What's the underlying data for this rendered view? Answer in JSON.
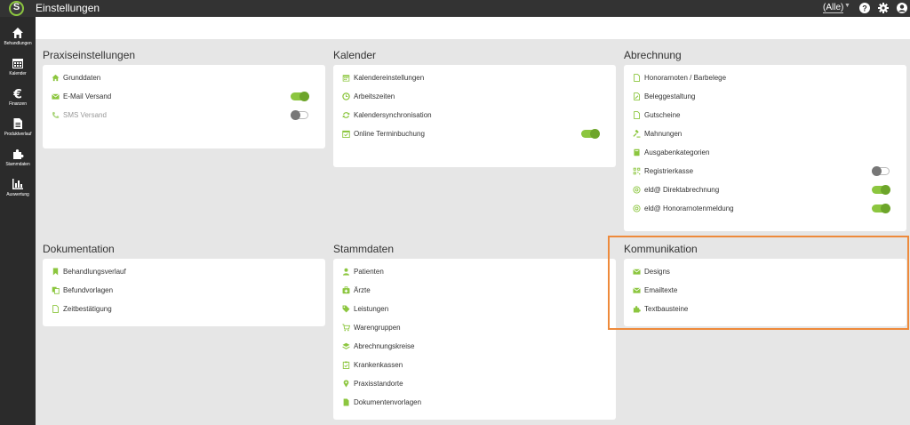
{
  "app": {
    "logo_letter": "S",
    "title": "Einstellungen",
    "filter_value": "(Alle)"
  },
  "colors": {
    "accent": "#8cc63f",
    "topbar": "#333333",
    "sidebar": "#2b2b2b",
    "highlight": "#ee8a3b"
  },
  "sidebar": {
    "items": [
      {
        "label": "Behandlungen",
        "icon": "home-icon"
      },
      {
        "label": "Kalender",
        "icon": "calendar-icon"
      },
      {
        "label": "Finanzen",
        "icon": "euro-icon"
      },
      {
        "label": "Produktverlauf",
        "icon": "document-icon"
      },
      {
        "label": "Stammdaten",
        "icon": "puzzle-icon"
      },
      {
        "label": "Auswertung",
        "icon": "bar-chart-icon"
      }
    ]
  },
  "sections": {
    "praxis": {
      "title": "Praxiseinstellungen",
      "items": [
        {
          "label": "Grunddaten",
          "icon": "home-icon"
        },
        {
          "label": "E-Mail Versand",
          "icon": "envelope-icon",
          "toggle": "on"
        },
        {
          "label": "SMS Versand",
          "icon": "phone-icon",
          "toggle": "off"
        }
      ]
    },
    "kalender": {
      "title": "Kalender",
      "items": [
        {
          "label": "Kalendereinstellungen",
          "icon": "calendar-icon"
        },
        {
          "label": "Arbeitszeiten",
          "icon": "clock-icon"
        },
        {
          "label": "Kalendersynchronisation",
          "icon": "sync-icon"
        },
        {
          "label": "Online Terminbuchung",
          "icon": "calendar-check-icon",
          "toggle": "on"
        }
      ]
    },
    "abrechnung": {
      "title": "Abrechnung",
      "items": [
        {
          "label": "Honorarnoten / Barbelege",
          "icon": "file-icon"
        },
        {
          "label": "Beleggestaltung",
          "icon": "file-edit-icon"
        },
        {
          "label": "Gutscheine",
          "icon": "file-icon"
        },
        {
          "label": "Mahnungen",
          "icon": "gavel-icon"
        },
        {
          "label": "Ausgabenkategorien",
          "icon": "book-icon"
        },
        {
          "label": "Registrierkasse",
          "icon": "qr-icon",
          "toggle": "off"
        },
        {
          "label": "eld@ Direktabrechnung",
          "icon": "at-icon",
          "toggle": "on"
        },
        {
          "label": "eld@ Honorarnotenmeldung",
          "icon": "at-icon",
          "toggle": "on"
        }
      ]
    },
    "dokumentation": {
      "title": "Dokumentation",
      "items": [
        {
          "label": "Behandlungsverlauf",
          "icon": "bookmark-icon"
        },
        {
          "label": "Befundvorlagen",
          "icon": "copy-icon"
        },
        {
          "label": "Zeitbestätigung",
          "icon": "file-icon"
        }
      ]
    },
    "stammdaten": {
      "title": "Stammdaten",
      "items": [
        {
          "label": "Patienten",
          "icon": "user-icon"
        },
        {
          "label": "Ärzte",
          "icon": "medkit-icon"
        },
        {
          "label": "Leistungen",
          "icon": "tag-icon"
        },
        {
          "label": "Warengruppen",
          "icon": "cart-icon"
        },
        {
          "label": "Abrechnungskreise",
          "icon": "layers-icon"
        },
        {
          "label": "Krankenkassen",
          "icon": "clipboard-icon"
        },
        {
          "label": "Praxisstandorte",
          "icon": "map-marker-icon"
        },
        {
          "label": "Dokumentenvorlagen",
          "icon": "file-icon"
        }
      ]
    },
    "kommunikation": {
      "title": "Kommunikation",
      "items": [
        {
          "label": "Designs",
          "icon": "envelope-icon"
        },
        {
          "label": "Emailtexte",
          "icon": "envelope-icon"
        },
        {
          "label": "Textbausteine",
          "icon": "puzzle-icon"
        }
      ]
    }
  }
}
